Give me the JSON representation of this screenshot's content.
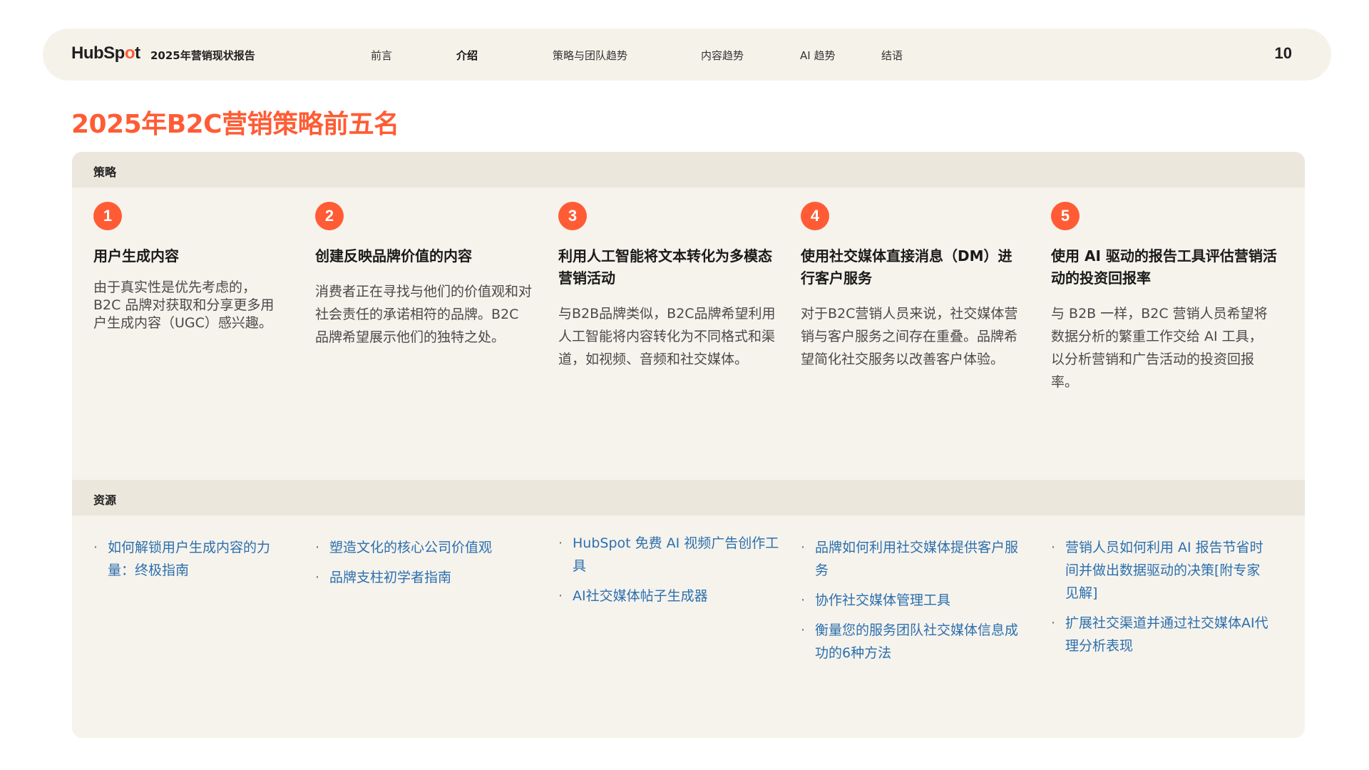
{
  "header": {
    "logo_text_a": "HubSp",
    "logo_text_b": "o",
    "logo_text_c": "t",
    "report_title": "2025年营销现状报告",
    "nav": [
      {
        "label": "前言"
      },
      {
        "label": "介绍",
        "active": true
      },
      {
        "label": "策略与团队趋势"
      },
      {
        "label": "内容趋势"
      },
      {
        "label": "AI 趋势"
      },
      {
        "label": "结语"
      }
    ],
    "page_number": "10"
  },
  "main": {
    "title": "2025年B2C营销策略前五名",
    "strategy_header": "策略",
    "resources_header": "资源",
    "accent_color": "#ff5c35",
    "link_color": "#2c6fae",
    "columns": [
      {
        "number": "1",
        "title": "用户生成内容",
        "description": "由于真实性是优先考虑的，B2C 品牌对获取和分享更多用户生成内容（UGC）感兴趣。",
        "resources": [
          "如何解锁用户生成内容的力量：终极指南"
        ]
      },
      {
        "number": "2",
        "title": "创建反映品牌价值的内容",
        "description": "消费者正在寻找与他们的价值观和对社会责任的承诺相符的品牌。B2C 品牌希望展示他们的独特之处。",
        "resources": [
          "塑造文化的核心公司价值观",
          "品牌支柱初学者指南"
        ]
      },
      {
        "number": "3",
        "title": "利用人工智能将文本转化为多模态营销活动",
        "description": "与B2B品牌类似，B2C品牌希望利用人工智能将内容转化为不同格式和渠道，如视频、音频和社交媒体。",
        "resources": [
          "HubSpot 免费 AI 视频广告创作工具",
          "AI社交媒体帖子生成器"
        ]
      },
      {
        "number": "4",
        "title": "使用社交媒体直接消息（DM）进行客户服务",
        "description": "对于B2C营销人员来说，社交媒体营销与客户服务之间存在重叠。品牌希望简化社交服务以改善客户体验。",
        "resources": [
          "品牌如何利用社交媒体提供客户服务",
          "协作社交媒体管理工具",
          "衡量您的服务团队社交媒体信息成功的6种方法"
        ]
      },
      {
        "number": "5",
        "title": "使用 AI 驱动的报告工具评估营销活动的投资回报率",
        "description": "与 B2B 一样，B2C 营销人员希望将数据分析的繁重工作交给 AI 工具，以分析营销和广告活动的投资回报率。",
        "resources": [
          "营销人员如何利用 AI 报告节省时间并做出数据驱动的决策[附专家见解]",
          "扩展社交渠道并通过社交媒体AI代理分析表现"
        ]
      }
    ]
  }
}
